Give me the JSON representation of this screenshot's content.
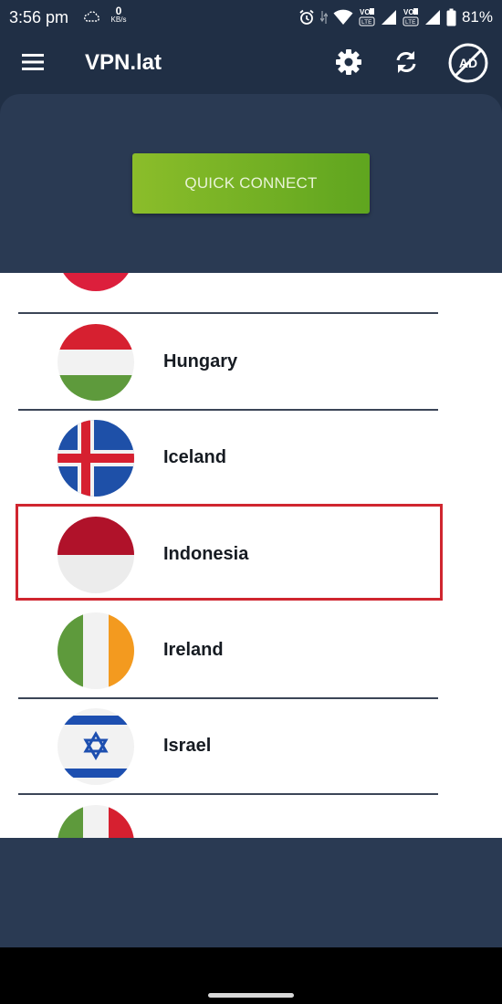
{
  "status_bar": {
    "time": "3:56 pm",
    "net_speed_value": "0",
    "net_speed_unit": "KB/s",
    "sim1_label": "VO 1 LTE",
    "sim2_label": "VO 2 LTE",
    "battery": "81%"
  },
  "app_bar": {
    "title": "VPN.lat",
    "ad_badge": "AD"
  },
  "main": {
    "quick_connect_label": "QUICK CONNECT"
  },
  "countries": [
    {
      "name": "Hungary"
    },
    {
      "name": "Iceland"
    },
    {
      "name": "Indonesia",
      "highlighted": true
    },
    {
      "name": "Ireland"
    },
    {
      "name": "Israel"
    }
  ],
  "colors": {
    "background": "#202f45",
    "card": "#2a3a53",
    "accent_green": "#6aaa22",
    "highlight_red": "#d0262f"
  }
}
